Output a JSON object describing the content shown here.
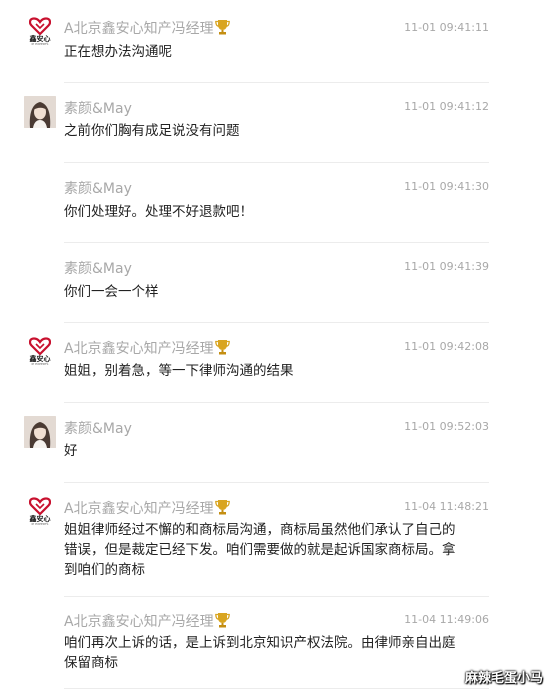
{
  "messages": [
    {
      "sender": "A北京鑫安心知产冯经理",
      "sender_trophy": true,
      "avatar": "brand",
      "time": "11-01 09:41:11",
      "text": "正在想办法沟通呢"
    },
    {
      "sender": "素颜&May",
      "sender_trophy": false,
      "avatar": "photo",
      "time": "11-01 09:41:12",
      "text": "之前你们胸有成足说没有问题"
    },
    {
      "sender": "素颜&May",
      "sender_trophy": false,
      "avatar": "none",
      "time": "11-01 09:41:30",
      "text": "你们处理好。处理不好退款吧！"
    },
    {
      "sender": "素颜&May",
      "sender_trophy": false,
      "avatar": "none",
      "time": "11-01 09:41:39",
      "text": "你们一会一个样"
    },
    {
      "sender": "A北京鑫安心知产冯经理",
      "sender_trophy": true,
      "avatar": "brand",
      "time": "11-01 09:42:08",
      "text": "姐姐，别着急，等一下律师沟通的结果"
    },
    {
      "sender": "素颜&May",
      "sender_trophy": false,
      "avatar": "photo",
      "time": "11-01 09:52:03",
      "text": "好"
    },
    {
      "sender": "A北京鑫安心知产冯经理",
      "sender_trophy": true,
      "avatar": "brand",
      "time": "11-04 11:48:21",
      "text": "姐姐律师经过不懈的和商标局沟通，商标局虽然他们承认了自己的错误，但是裁定已经下发。咱们需要做的就是起诉国家商标局。拿到咱们的商标"
    },
    {
      "sender": "A北京鑫安心知产冯经理",
      "sender_trophy": true,
      "avatar": "none",
      "time": "11-04 11:49:06",
      "text": "咱们再次上诉的话，是上诉到北京知识产权法院。由律师亲自出庭保留商标"
    }
  ],
  "brand_avatar": {
    "text": "鑫安心",
    "sub": "IP EXPERTS"
  },
  "watermark": "麻辣毛蛋小马",
  "colors": {
    "meta_gray": "#a8a8a8",
    "text": "#222222",
    "divider": "#ececec",
    "brand_red": "#c8102e",
    "trophy_gold": "#d9a520"
  }
}
